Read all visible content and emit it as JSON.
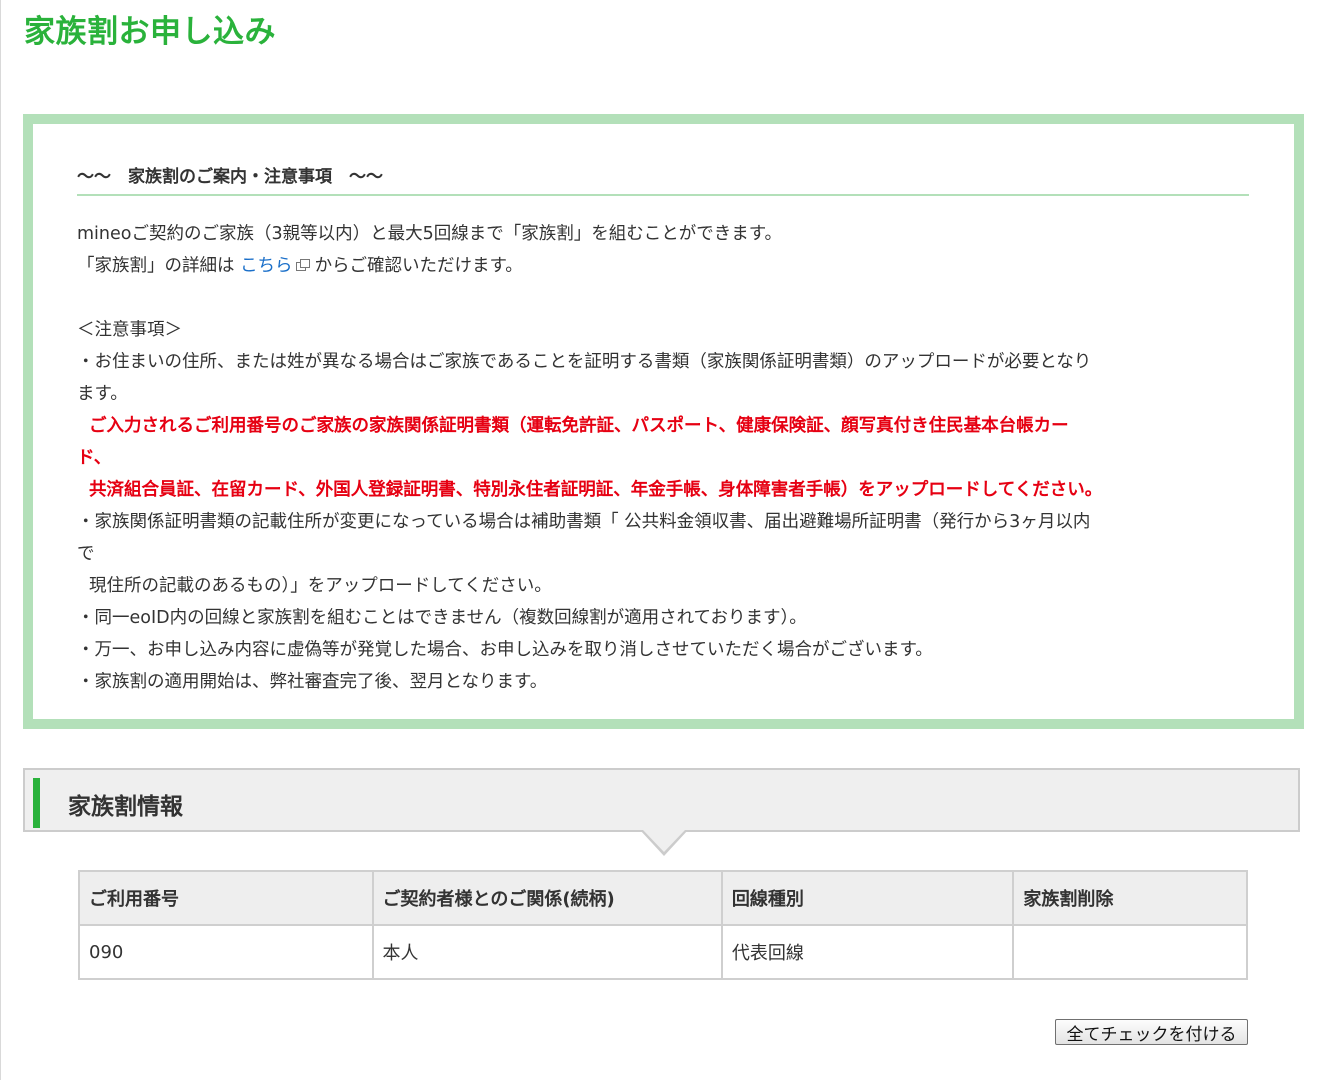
{
  "page": {
    "title": "家族割お申し込み"
  },
  "notice": {
    "heading": "〜〜　家族割のご案内・注意事項　〜〜",
    "intro_line1": "mineoご契約のご家族（3親等以内）と最大5回線まで「家族割」を組むことができます。",
    "intro_line2_prefix": "「家族割」の詳細は ",
    "intro_link_text": "こちら",
    "intro_line2_suffix": "からご確認いただけます。",
    "caution_title": "＜注意事項＞",
    "caution_1_a": "・お住まいの住所、または姓が異なる場合はご家族であることを証明する書類（家族関係証明書類）のアップロードが必要となり",
    "caution_1_b": "ます。",
    "red_1_a": "ご入力されるご利用番号のご家族の家族関係証明書類（運転免許証、パスポート、健康保険証、顔写真付き住民基本台帳カー",
    "red_1_b": "ド、",
    "red_2": "共済組合員証、在留カード、外国人登録証明書、特別永住者証明証、年金手帳、身体障害者手帳）をアップロードしてください。",
    "caution_2_a": "・家族関係証明書類の記載住所が変更になっている場合は補助書類「 公共料金領収書、届出避難場所証明書（発行から3ヶ月以内",
    "caution_2_b": "で",
    "caution_2_c": "現住所の記載のあるもの）」をアップロードしてください。",
    "caution_3": "・同一eoID内の回線と家族割を組むことはできません（複数回線割が適用されております）。",
    "caution_4": "・万一、お申し込み内容に虚偽等が発覚した場合、お申し込みを取り消しさせていただく場合がございます。",
    "caution_5": "・家族割の適用開始は、弊社審査完了後、翌月となります。"
  },
  "family_info": {
    "section_title": "家族割情報",
    "columns": [
      "ご利用番号",
      "ご契約者様とのご関係(続柄)",
      "回線種別",
      "家族割削除"
    ],
    "rows": [
      {
        "number": "090",
        "relation": "本人",
        "line_type": "代表回線",
        "delete": ""
      }
    ],
    "check_all_label": "全てチェックを付ける"
  },
  "colors": {
    "accent_green": "#2ab23b",
    "box_border": "#b3e0b9",
    "warning_red": "#e60012",
    "link_blue": "#1a6fc9"
  }
}
